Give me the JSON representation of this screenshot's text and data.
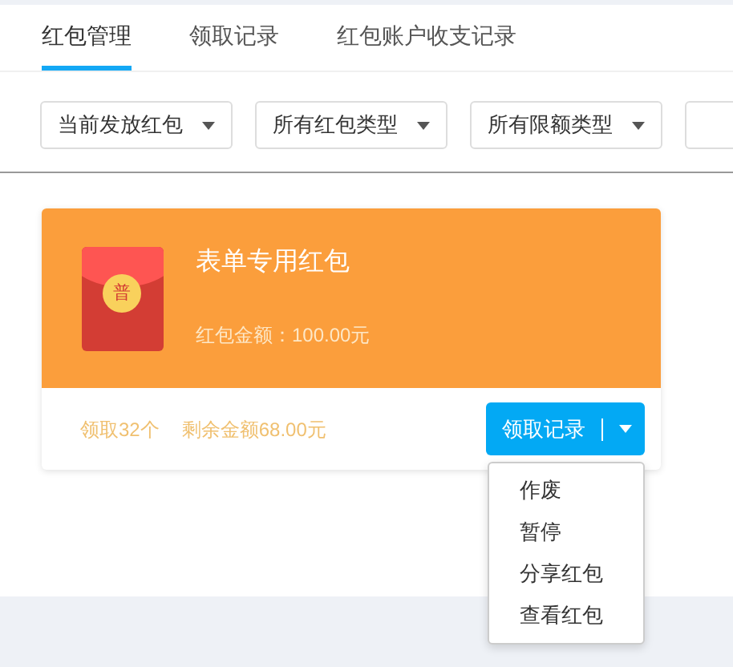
{
  "tabs": [
    {
      "label": "红包管理",
      "selected": true
    },
    {
      "label": "领取记录",
      "selected": false
    },
    {
      "label": "红包账户收支记录",
      "selected": false
    }
  ],
  "filters": [
    {
      "value": "当前发放红包"
    },
    {
      "value": "所有红包类型"
    },
    {
      "value": "所有限额类型"
    }
  ],
  "card": {
    "badge": "普",
    "title": "表单专用红包",
    "amount": "红包金额：100.00元",
    "claimed": "领取32个",
    "remaining": "剩余金额68.00元",
    "button": "领取记录",
    "menu_expanded": true,
    "menu": [
      "作废",
      "暂停",
      "分享红包",
      "查看红包"
    ]
  }
}
